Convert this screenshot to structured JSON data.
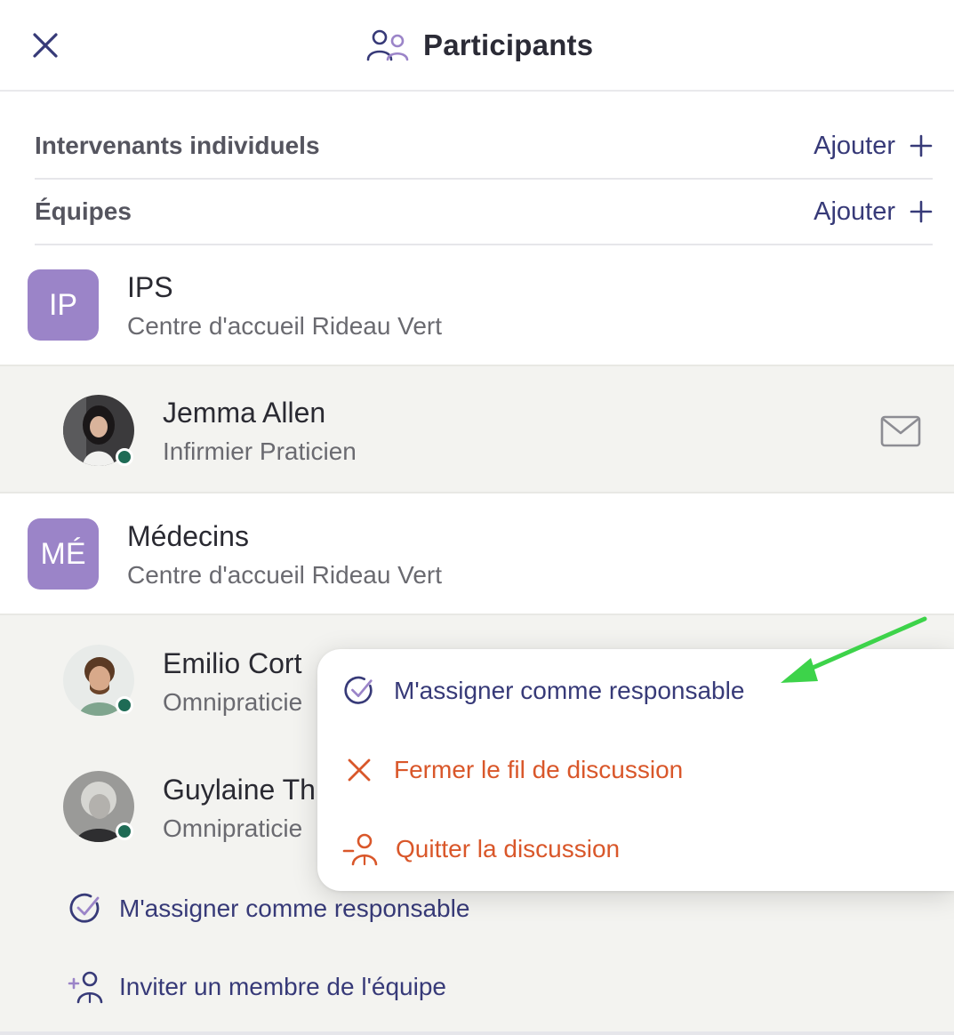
{
  "header": {
    "title": "Participants"
  },
  "sections": {
    "individuals": {
      "label": "Intervenants individuels",
      "add_label": "Ajouter"
    },
    "teams": {
      "label": "Équipes",
      "add_label": "Ajouter"
    }
  },
  "teams": [
    {
      "initials": "IP",
      "name": "IPS",
      "location": "Centre d'accueil Rideau Vert",
      "members": [
        {
          "name": "Jemma Allen",
          "role": "Infirmier Praticien"
        }
      ]
    },
    {
      "initials": "MÉ",
      "name": "Médecins",
      "location": "Centre d'accueil Rideau Vert",
      "members": [
        {
          "name": "Emilio Cort",
          "role": "Omnipraticie"
        },
        {
          "name": "Guylaine Th",
          "role": "Omnipraticie"
        }
      ],
      "actions": {
        "assign": "M'assigner comme responsable",
        "invite": "Inviter un membre de l'équipe"
      }
    }
  ],
  "context_menu": {
    "items": [
      {
        "label": "M'assigner comme responsable",
        "icon": "check-circle-icon"
      },
      {
        "label": "Fermer le fil de discussion",
        "icon": "close-icon"
      },
      {
        "label": "Quitter la discussion",
        "icon": "leave-person-icon"
      }
    ]
  },
  "colors": {
    "accent": "#373a78",
    "danger": "#d9572a",
    "team_badge": "#9b84c8",
    "online": "#1e6b55",
    "annotation_arrow": "#3dd34a"
  }
}
